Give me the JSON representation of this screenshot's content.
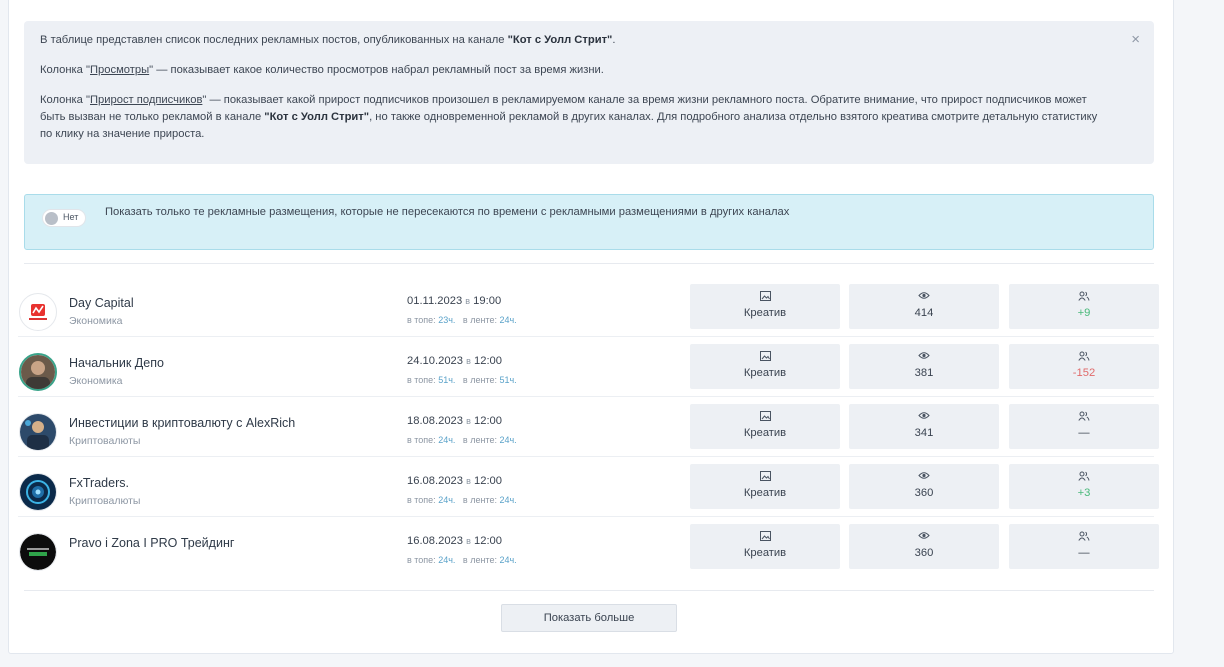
{
  "info": {
    "p1_prefix": "В таблице представлен список последних рекламных постов, опубликованных на канале ",
    "channel_name": "\"Кот с Уолл Стрит\"",
    "p1_suffix": ".",
    "p2_prefix": "Колонка \"",
    "p2_link": "Просмотры",
    "p2_suffix": "\" — показывает какое количество просмотров набрал рекламный пост за время жизни.",
    "p3_prefix": "Колонка \"",
    "p3_link": "Прирост подписчиков",
    "p3_mid1": "\" — показывает какой прирост подписчиков произошел в рекламируемом канале за время жизни рекламного поста. Обратите внимание, что прирост подписчиков может быть вызван не только рекламой в канале ",
    "p3_bold": "\"Кот с Уолл Стрит\"",
    "p3_mid2": ", но также одновременной рекламой в других каналах. Для подробного анализа отдельно взятого креатива смотрите детальную статистику по клику на значение прироста.",
    "close": "×"
  },
  "filter": {
    "toggle_label": "Нет",
    "text": "Показать только те рекламные размещения, которые не пересекаются по времени с рекламными размещениями в других каналах"
  },
  "labels": {
    "in_top": "в топе:",
    "in_feed": "в ленте:",
    "at": "в",
    "creative": "Креатив"
  },
  "rows": [
    {
      "name": "Day Capital",
      "category": "Экономика",
      "date": "01.11.2023",
      "time": "19:00",
      "top": "23ч.",
      "feed": "24ч.",
      "views": "414",
      "growth": "+9",
      "growth_type": "pos"
    },
    {
      "name": "Начальник Депо",
      "category": "Экономика",
      "date": "24.10.2023",
      "time": "12:00",
      "top": "51ч.",
      "feed": "51ч.",
      "views": "381",
      "growth": "-152",
      "growth_type": "neg"
    },
    {
      "name": "Инвестиции в криптовалюту с AlexRich",
      "category": "Криптовалюты",
      "date": "18.08.2023",
      "time": "12:00",
      "top": "24ч.",
      "feed": "24ч.",
      "views": "341",
      "growth": "—",
      "growth_type": "none"
    },
    {
      "name": "FxTraders.",
      "category": "Криптовалюты",
      "date": "16.08.2023",
      "time": "12:00",
      "top": "24ч.",
      "feed": "24ч.",
      "views": "360",
      "growth": "+3",
      "growth_type": "pos"
    },
    {
      "name": "Pravo i Zona I PRO Трейдинг",
      "category": "",
      "date": "16.08.2023",
      "time": "12:00",
      "top": "24ч.",
      "feed": "24ч.",
      "views": "360",
      "growth": "—",
      "growth_type": "none"
    }
  ],
  "show_more": "Показать больше",
  "colors": {
    "positive": "#49b97a",
    "negative": "#e06a6a",
    "info_bg": "#edf0f5",
    "filter_bg": "#d7f0f7"
  }
}
